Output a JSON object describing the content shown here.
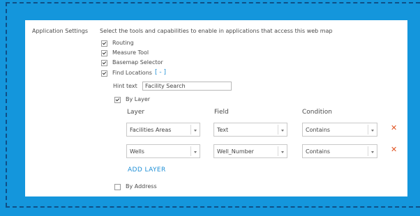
{
  "panel": {
    "section_label": "Application Settings",
    "description": "Select the tools and capabilities to enable in applications that access this web map"
  },
  "options": [
    {
      "label": "Routing",
      "checked": true
    },
    {
      "label": "Measure Tool",
      "checked": true
    },
    {
      "label": "Basemap Selector",
      "checked": true
    },
    {
      "label": "Find Locations",
      "checked": true
    }
  ],
  "find_locations": {
    "toggle": "[ - ]",
    "hint_label": "Hint text",
    "hint_value": "Facility Search",
    "by_layer": {
      "label": "By Layer",
      "checked": true
    },
    "by_address": {
      "label": "By Address",
      "checked": false
    },
    "columns": {
      "layer": "Layer",
      "field": "Field",
      "condition": "Condition"
    },
    "rows": [
      {
        "layer": "Facilities Areas",
        "field": "Text",
        "condition": "Contains"
      },
      {
        "layer": "Wells",
        "field": "Well_Number",
        "condition": "Contains"
      }
    ],
    "add_layer": "ADD LAYER"
  },
  "icons": {
    "delete": "close-x-icon",
    "dropdown": "chevron-down-icon"
  },
  "colors": {
    "background": "#1496dc",
    "accent": "#1e8fd6",
    "delete": "#e0521f"
  }
}
